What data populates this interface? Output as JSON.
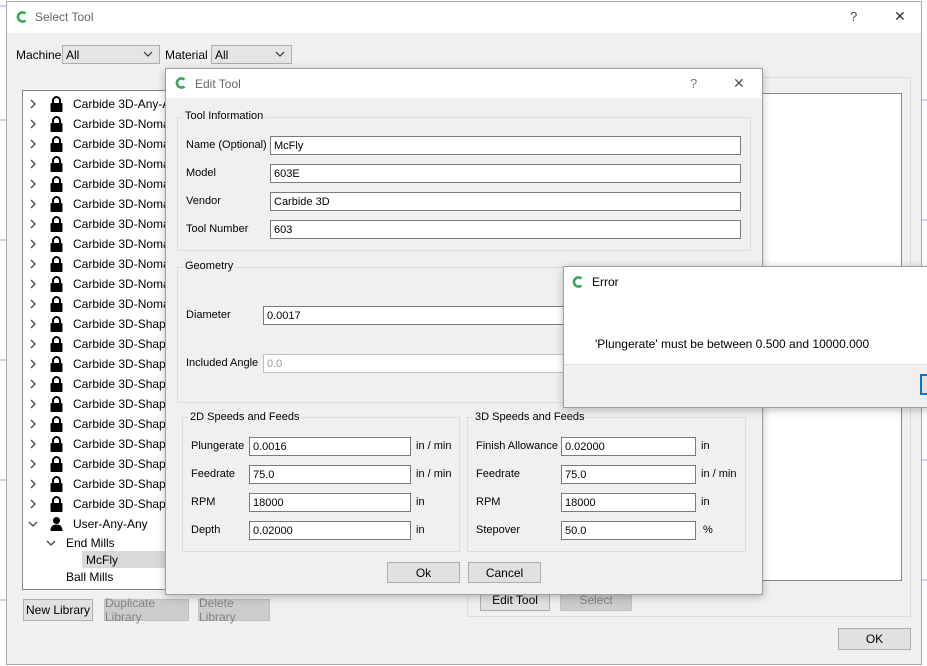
{
  "select_tool": {
    "title": "Select Tool",
    "help": "?",
    "close": "✕",
    "machine_label": "Machine",
    "machine_value": "All",
    "material_label": "Material",
    "material_value": "All",
    "library_items": [
      "Carbide 3D-Any-A",
      "Carbide 3D-Nomac",
      "Carbide 3D-Nomac",
      "Carbide 3D-Nomac",
      "Carbide 3D-Nomac",
      "Carbide 3D-Nomac",
      "Carbide 3D-Nomac",
      "Carbide 3D-Nomac",
      "Carbide 3D-Nomac",
      "Carbide 3D-Nomac",
      "Carbide 3D-Nomac",
      "Carbide 3D-Shapec",
      "Carbide 3D-Shapec",
      "Carbide 3D-Shapec",
      "Carbide 3D-Shapec",
      "Carbide 3D-Shapec",
      "Carbide 3D-Shapec",
      "Carbide 3D-Shapec",
      "Carbide 3D-Shapec",
      "Carbide 3D-Shapec",
      "Carbide 3D-Shapec"
    ],
    "user_library": "User-Any-Any",
    "end_mills": "End Mills",
    "selected_tool": "McFly",
    "ball_mills": "Ball Mills",
    "new_library": "New Library",
    "duplicate_library": "Duplicate Library",
    "delete_library": "Delete Library",
    "edit_tool": "Edit Tool",
    "select": "Select",
    "ok": "OK"
  },
  "edit_tool": {
    "title": "Edit Tool",
    "help": "?",
    "close": "✕",
    "tool_info_title": "Tool Information",
    "name_label": "Name (Optional)",
    "name_value": "McFly",
    "model_label": "Model",
    "model_value": "603E",
    "vendor_label": "Vendor",
    "vendor_value": "Carbide 3D",
    "tool_number_label": "Tool Number",
    "tool_number_value": "603",
    "geometry_title": "Geometry",
    "diameter_label": "Diameter",
    "diameter_value": "0.0017",
    "included_angle_label": "Included Angle",
    "included_angle_value": "0.0",
    "speeds2d_title": "2D Speeds and Feeds",
    "plungerate_label": "Plungerate",
    "plungerate_value": "0.0016",
    "plungerate_unit": "in / min",
    "feedrate_label": "Feedrate",
    "feedrate_value": "75.0",
    "feedrate_unit": "in / min",
    "rpm_label": "RPM",
    "rpm_value": "18000",
    "rpm_unit": "in",
    "depth_label": "Depth",
    "depth_value": "0.02000",
    "depth_unit": "in",
    "speeds3d_title": "3D Speeds and Feeds",
    "finish_label": "Finish Allowance",
    "finish_value": "0.02000",
    "finish_unit": "in",
    "feedrate3d_label": "Feedrate",
    "feedrate3d_value": "75.0",
    "feedrate3d_unit": "in / min",
    "rpm3d_label": "RPM",
    "rpm3d_value": "18000",
    "rpm3d_unit": "in",
    "stepover_label": "Stepover",
    "stepover_value": "50.0",
    "stepover_unit": "%",
    "ok": "Ok",
    "cancel": "Cancel"
  },
  "error": {
    "title": "Error",
    "message": "'Plungerate' must be between 0.500 and 10000.000"
  },
  "colors": {
    "brand": "#3aa655",
    "dialog_bg": "#f0f0f0",
    "selection": "#cce8ff"
  }
}
